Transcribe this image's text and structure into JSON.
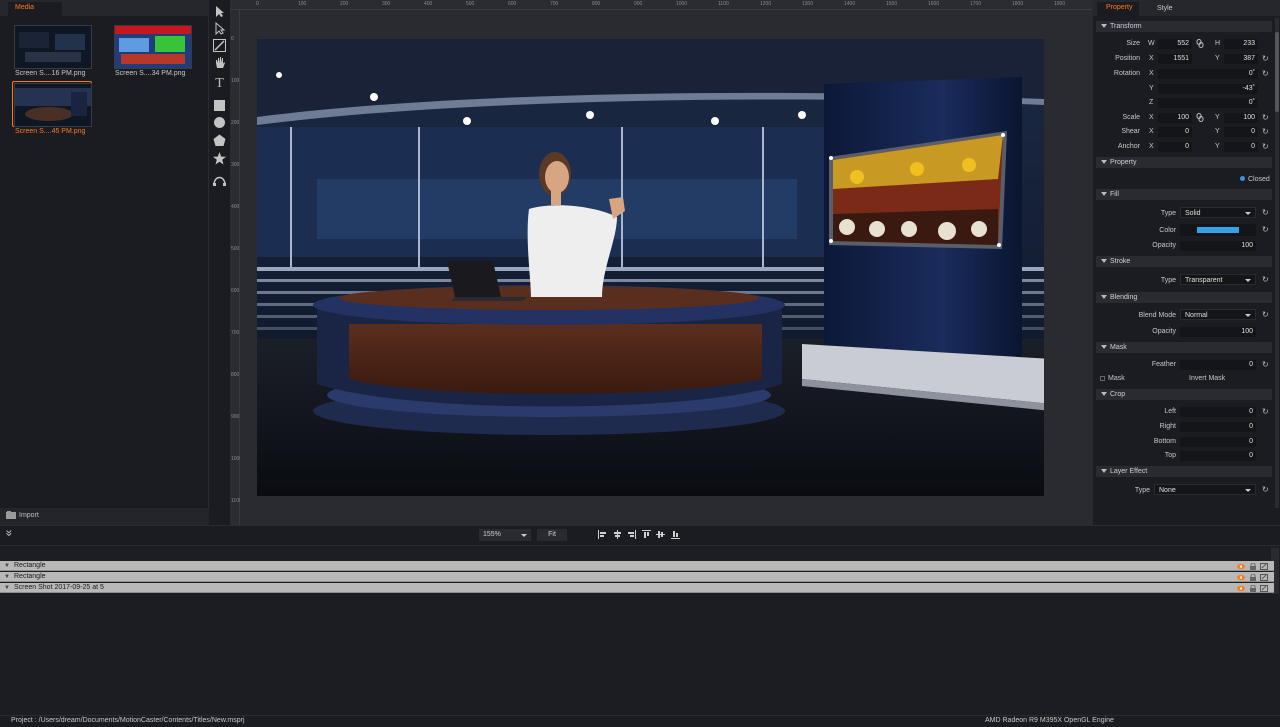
{
  "media": {
    "tab": "Media",
    "items": [
      {
        "label": "Screen S....16 PM.png"
      },
      {
        "label": "Screen S....34 PM.png"
      },
      {
        "label": "Screen S....45 PM.png"
      }
    ],
    "import_label": "Import"
  },
  "tools": [
    "select-arrow-icon",
    "direct-select-icon",
    "pen-icon",
    "hand-icon",
    "text-icon",
    "rectangle-icon",
    "ellipse-icon",
    "polygon-icon",
    "star-icon",
    "curve-icon"
  ],
  "ruler": {
    "top": [
      "0",
      "100",
      "200",
      "300",
      "400",
      "500",
      "600",
      "700",
      "800",
      "900",
      "1000",
      "1100",
      "1200",
      "1300",
      "1400",
      "1500",
      "1600",
      "1700",
      "1800",
      "1900"
    ],
    "left": [
      "0",
      "100",
      "200",
      "300",
      "400",
      "500",
      "600",
      "700",
      "800",
      "900",
      "1000",
      "1100"
    ]
  },
  "panel_tabs": {
    "property": "Property",
    "style": "Style"
  },
  "transform": {
    "title": "Transform",
    "size_label": "Size",
    "w_axis": "W",
    "w": "552",
    "h_axis": "H",
    "h": "233",
    "position_label": "Position",
    "px_axis": "X",
    "px": "1551",
    "py_axis": "Y",
    "py": "387",
    "rotation_label": "Rotation",
    "rx_axis": "X",
    "rx": "0˚",
    "ry_axis": "Y",
    "ry": "-43˚",
    "rz_axis": "Z",
    "rz": "0˚",
    "scale_label": "Scale",
    "sx_axis": "X",
    "sx": "100",
    "sy_axis": "Y",
    "sy": "100",
    "shear_label": "Shear",
    "shx_axis": "X",
    "shx": "0",
    "shy_axis": "Y",
    "shy": "0",
    "anchor_label": "Anchor",
    "ax_axis": "X",
    "ax": "0",
    "ay_axis": "Y",
    "ay": "0"
  },
  "property": {
    "title": "Property",
    "closed_label": "Closed"
  },
  "fill": {
    "title": "Fill",
    "type_label": "Type",
    "type_value": "Solid",
    "color_label": "Color",
    "color": "#3aa0e8",
    "opacity_label": "Opacity",
    "opacity": "100"
  },
  "stroke": {
    "title": "Stroke",
    "type_label": "Type",
    "type_value": "Transparent"
  },
  "blending": {
    "title": "Blending",
    "mode_label": "Blend Mode",
    "mode_value": "Normal",
    "opacity_label": "Opacity",
    "opacity": "100"
  },
  "mask": {
    "title": "Mask",
    "feather_label": "Feather",
    "feather": "0",
    "mask_label": "Mask",
    "invert_label": "Invert Mask"
  },
  "crop": {
    "title": "Crop",
    "left_label": "Left",
    "left": "0",
    "right_label": "Right",
    "right": "0",
    "bottom_label": "Bottom",
    "bottom": "0",
    "top_label": "Top",
    "top": "0"
  },
  "layer_effect": {
    "title": "Layer Effect",
    "type_label": "Type",
    "type_value": "None"
  },
  "toolbar": {
    "zoom": "155%",
    "fit_label": "Fit"
  },
  "layers": [
    {
      "name": "Rectangle"
    },
    {
      "name": "Rectangle"
    },
    {
      "name": "Screen Shot 2017-09-25 at 5"
    }
  ],
  "status": {
    "project": "Project : /Users/dream/Documents/MotionCaster/Contents/Titles/New.msprj",
    "engine": "AMD Radeon R9 M395X OpenGL Engine"
  },
  "colors": {
    "accent": "#ff7a1a",
    "fill_color": "#3aa0e8",
    "status_dot": "#3a8fe8"
  }
}
